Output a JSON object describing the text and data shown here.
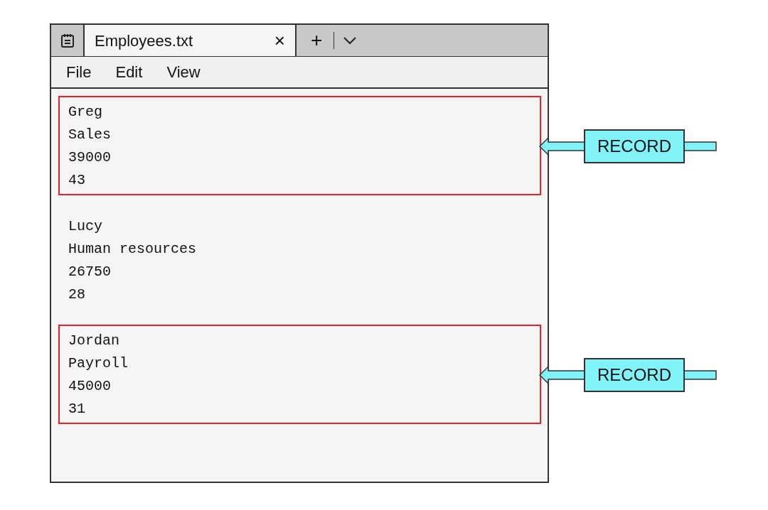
{
  "window": {
    "tab": {
      "title": "Employees.txt",
      "close": "×",
      "selected": true
    },
    "new_tab": "+"
  },
  "menu": [
    {
      "label": "File"
    },
    {
      "label": "Edit"
    },
    {
      "label": "View"
    }
  ],
  "groups": [
    {
      "lines": [
        "Greg",
        "Sales",
        "39000",
        "43"
      ],
      "highlighted": true,
      "label": "RECORD"
    },
    {
      "lines": [
        "Lucy",
        "Human resources",
        "26750",
        "28"
      ],
      "highlighted": false
    },
    {
      "lines": [
        "Jordan",
        "Payroll",
        "45000",
        "31"
      ],
      "highlighted": true,
      "label": "RECORD"
    }
  ]
}
